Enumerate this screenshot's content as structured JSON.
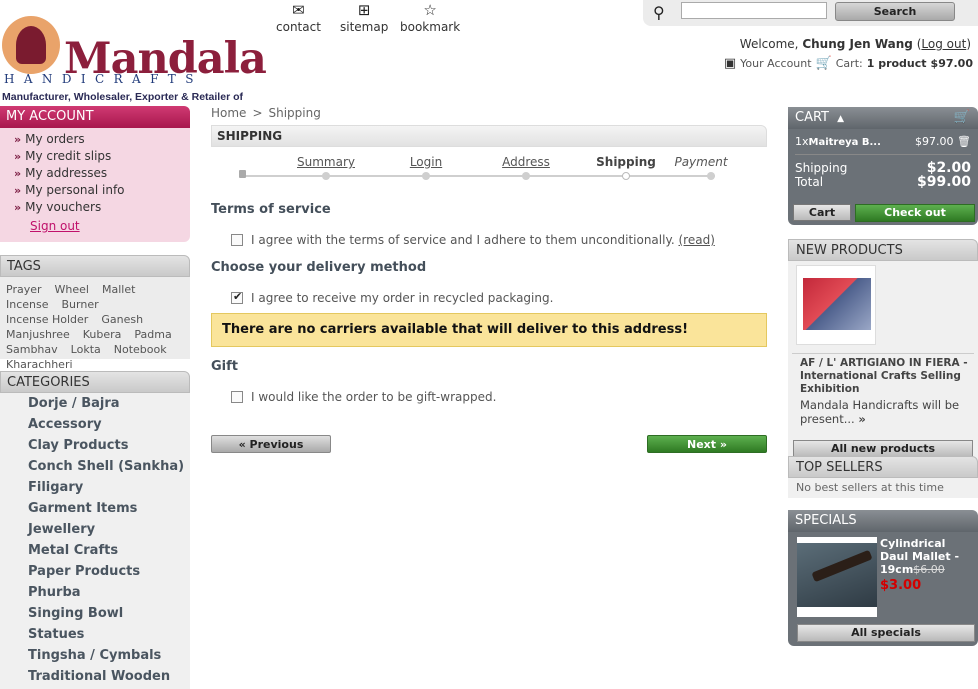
{
  "logo": {
    "brand": "Mandala",
    "sub": "HANDICRAFTS",
    "tagline": "Manufacturer, Wholesaler, Exporter & Retailer of"
  },
  "toplinks": {
    "contact": "contact",
    "sitemap": "sitemap",
    "bookmark": "bookmark"
  },
  "search": {
    "button": "Search",
    "value": ""
  },
  "user": {
    "welcome": "Welcome,",
    "name": "Chung Jen Wang",
    "logout": "Log out",
    "account": "Your Account",
    "cart_label": "Cart:",
    "cart_count": "1 product",
    "cart_total": "$97.00"
  },
  "myaccount": {
    "title": "MY ACCOUNT",
    "items": [
      "My orders",
      "My credit slips",
      "My addresses",
      "My personal info",
      "My vouchers"
    ],
    "signout": "Sign out"
  },
  "tags": {
    "title": "TAGS",
    "items": [
      "Prayer",
      "Wheel",
      "Mallet",
      "Incense",
      "Burner",
      "Incense Holder",
      "Ganesh",
      "Manjushree",
      "Kubera",
      "Padma",
      "Sambhav",
      "Lokta",
      "Notebook",
      "Kharachheri"
    ]
  },
  "categories": {
    "title": "CATEGORIES",
    "items": [
      "Dorje / Bajra",
      "Accessory",
      "Clay Products",
      "Conch Shell (Sankha)",
      "Filigary",
      "Garment Items",
      "Jewellery",
      "Metal Crafts",
      "Paper Products",
      "Phurba",
      "Singing Bowl",
      "Statues",
      "Tingsha / Cymbals",
      "Traditional Wooden"
    ]
  },
  "breadcrumb": {
    "home": "Home",
    "sep": ">",
    "current": "Shipping"
  },
  "page": {
    "title": "SHIPPING"
  },
  "steps": {
    "summary": "Summary",
    "login": "Login",
    "address": "Address",
    "shipping": "Shipping",
    "payment": "Payment"
  },
  "tos": {
    "title": "Terms of service",
    "text": "I agree with the terms of service and I adhere to them unconditionally.",
    "read": "(read)",
    "checked": false
  },
  "delivery": {
    "title": "Choose your delivery method",
    "recycled": "I agree to receive my order in recycled packaging.",
    "checked": true,
    "warning": "There are no carriers available that will deliver to this address!"
  },
  "gift": {
    "title": "Gift",
    "text": "I would like the order to be gift-wrapped.",
    "checked": false
  },
  "nav": {
    "previous": "« Previous",
    "next": "Next »"
  },
  "cart": {
    "title": "CART",
    "qty": "1x",
    "item": "Maitreya B...",
    "price": "$97.00",
    "shipping_label": "Shipping",
    "shipping": "$2.00",
    "total_label": "Total",
    "total": "$99.00",
    "cart_btn": "Cart",
    "checkout_btn": "Check out"
  },
  "newproducts": {
    "title": "NEW PRODUCTS",
    "name": "AF / L' ARTIGIANO IN FIERA - International Crafts Selling Exhibition",
    "desc": "Mandala Handicrafts will be present...",
    "all": "All new products"
  },
  "topsellers": {
    "title": "TOP SELLERS",
    "text": "No best sellers at this time"
  },
  "specials": {
    "title": "SPECIALS",
    "name": "Cylindrical Daul Mallet - 19cm",
    "old_price": "$6.00",
    "new_price": "$3.00",
    "all": "All specials"
  },
  "colors": {
    "accent": "#a8174d",
    "green": "#2f7a23",
    "warning_bg": "#fae49a",
    "special_price": "#d30000"
  }
}
